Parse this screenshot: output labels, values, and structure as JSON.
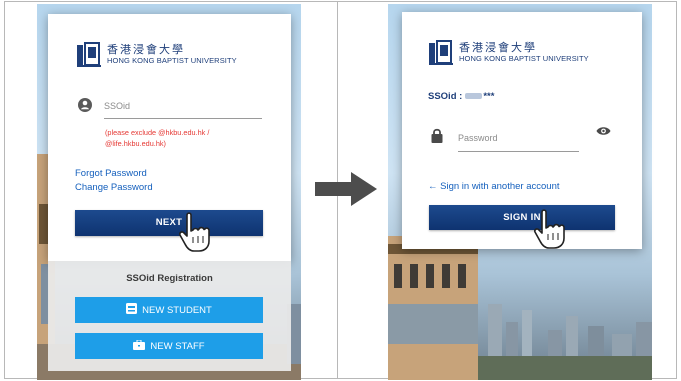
{
  "left_screen": {
    "logo": {
      "chinese_name": "香港浸會大學",
      "english_name": "HONG KONG BAPTIST UNIVERSITY"
    },
    "ssoid_field": {
      "placeholder": "SSOid",
      "icon": "user-circle-icon"
    },
    "hint_line1": "(please exclude @hkbu.edu.hk /",
    "hint_line2": "@life.hkbu.edu.hk)",
    "forgot_password": "Forgot Password",
    "change_password": "Change Password",
    "next_button": "NEXT",
    "registration_title": "SSOid Registration",
    "new_student_button": "NEW STUDENT",
    "new_staff_button": "NEW STAFF"
  },
  "right_screen": {
    "logo": {
      "chinese_name": "香港浸會大學",
      "english_name": "HONG KONG BAPTIST UNIVERSITY"
    },
    "ssoid_prefix": "SSOid :",
    "ssoid_suffix": "***",
    "password_field": {
      "placeholder": "Password",
      "icon": "lock-icon",
      "toggle_icon": "eye-icon"
    },
    "another_account_link": "← Sign in with another account",
    "sign_in_button": "SIGN IN"
  },
  "transition": {
    "icon": "right-arrow-icon"
  },
  "colors": {
    "primary": "#0e3370",
    "accent_blue": "#1e9ee8",
    "link": "#1560bd",
    "error": "#e53935"
  }
}
